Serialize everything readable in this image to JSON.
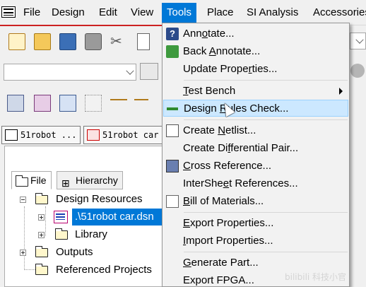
{
  "menubar": {
    "items": [
      "File",
      "Design",
      "Edit",
      "View",
      "Tools",
      "Place",
      "SI Analysis",
      "Accessories"
    ],
    "active": "Tools"
  },
  "doc_tabs": [
    "51robot ...",
    "51robot car"
  ],
  "panel": {
    "tabs": [
      "File",
      "Hierarchy"
    ],
    "tree": {
      "root": "Design Resources",
      "design_file": ".\\51robot car.dsn",
      "library": "Library",
      "outputs": "Outputs",
      "referenced": "Referenced Projects"
    }
  },
  "tools_menu": {
    "items": [
      {
        "pre": "Ann",
        "u": "o",
        "post": "tate...",
        "icon": "annotate-icon"
      },
      {
        "pre": "Back ",
        "u": "A",
        "post": "nnotate...",
        "icon": "back-annotate-icon"
      },
      {
        "pre": "Update Prope",
        "u": "r",
        "post": "ties...",
        "icon": ""
      },
      {
        "pre": "",
        "u": "T",
        "post": "est Bench",
        "icon": "",
        "submenu": true
      },
      {
        "pre": "Design ",
        "u": "R",
        "post": "ules Check...",
        "icon": "design-rules-check-icon",
        "highlighted": true
      },
      {
        "pre": "Create ",
        "u": "N",
        "post": "etlist...",
        "icon": "netlist-icon"
      },
      {
        "pre": "Create Di",
        "u": "f",
        "post": "ferential Pair...",
        "icon": ""
      },
      {
        "pre": "",
        "u": "C",
        "post": "ross Reference...",
        "icon": "cross-reference-icon"
      },
      {
        "pre": "InterShe",
        "u": "e",
        "post": "t References...",
        "icon": ""
      },
      {
        "pre": "",
        "u": "B",
        "post": "ill of Materials...",
        "icon": "bill-of-materials-icon"
      },
      {
        "pre": "",
        "u": "E",
        "post": "xport Properties...",
        "icon": ""
      },
      {
        "pre": "",
        "u": "I",
        "post": "mport Properties...",
        "icon": ""
      },
      {
        "pre": "",
        "u": "G",
        "post": "enerate Part...",
        "icon": ""
      },
      {
        "pre": "Export FPGA...",
        "u": "",
        "post": "",
        "icon": ""
      }
    ]
  },
  "watermark": "bilibili 科技小官",
  "colors": {
    "menu_highlight": "#0078d7",
    "hover_item": "#cce8ff",
    "accent_line": "#cc2222"
  }
}
